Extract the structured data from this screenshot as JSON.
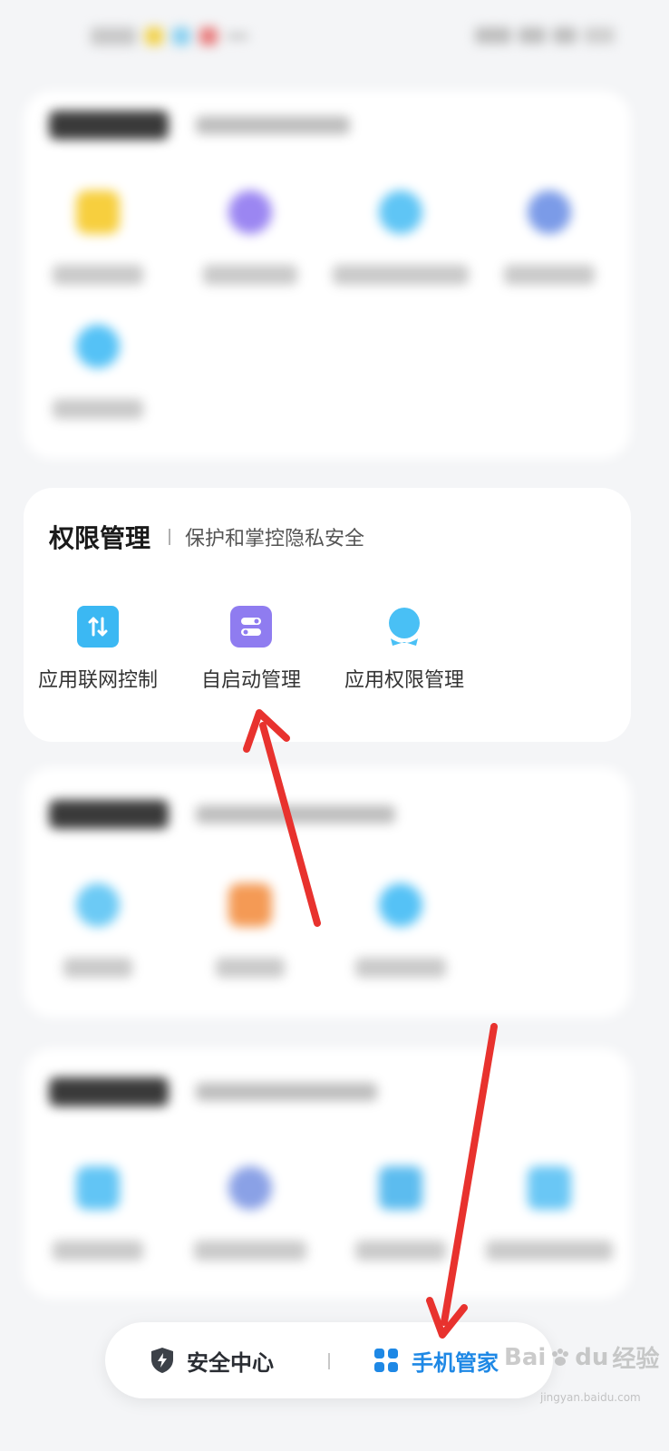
{
  "permission_card": {
    "title": "权限管理",
    "subtitle": "保护和掌控隐私安全",
    "items": [
      {
        "label": "应用联网控制",
        "icon": "network-arrows-icon",
        "color": "#3bb8f3"
      },
      {
        "label": "自启动管理",
        "icon": "toggle-switch-icon",
        "color": "#8f7cf0"
      },
      {
        "label": "应用权限管理",
        "icon": "user-badge-icon",
        "color": "#49c0f5"
      }
    ]
  },
  "bottom_nav": {
    "security": {
      "label": "安全中心",
      "icon": "shield-bolt-icon",
      "color": "#3c4148"
    },
    "manager": {
      "label": "手机管家",
      "icon": "four-squares-icon",
      "color": "#1e88e5"
    }
  },
  "watermark": {
    "brand": "Bai",
    "brand2": "du",
    "suffix": "经验",
    "url": "jingyan.baidu.com"
  },
  "annotation_color": "#e8322e"
}
